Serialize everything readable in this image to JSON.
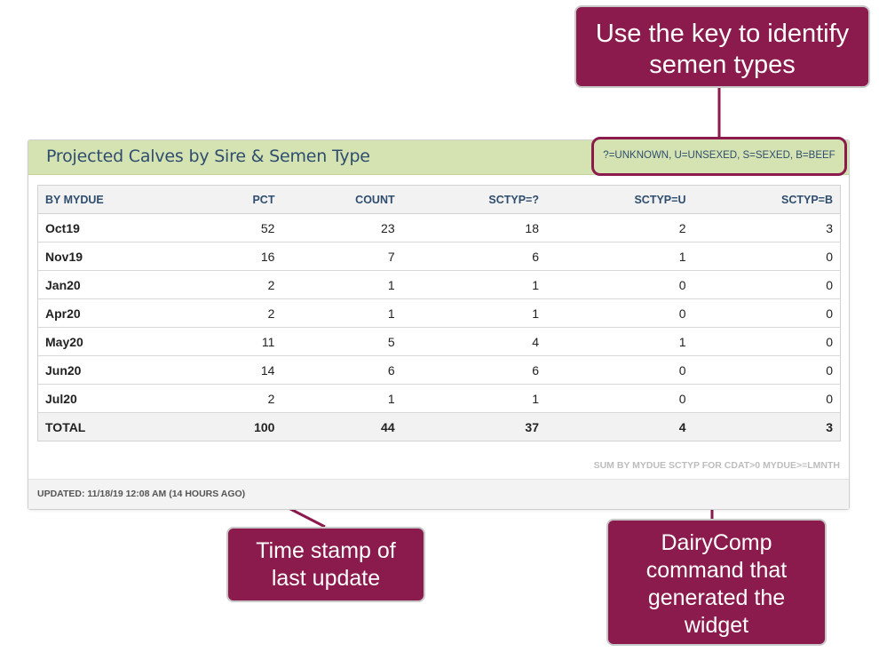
{
  "widget": {
    "title": "Projected Calves by Sire & Semen Type",
    "key": "?=UNKNOWN, U=UNSEXED, S=SEXED, B=BEEF",
    "command": "SUM BY MYDUE SCTYP FOR CDAT>0 MYDUE>=LMNTH",
    "updated": "UPDATED: 11/18/19 12:08 AM (14 HOURS AGO)"
  },
  "table": {
    "headers": [
      "BY MYDUE",
      "PCT",
      "COUNT",
      "SCTYP=?",
      "SCTYP=U",
      "SCTYP=B"
    ],
    "rows": [
      [
        "Oct19",
        "52",
        "23",
        "18",
        "2",
        "3"
      ],
      [
        "Nov19",
        "16",
        "7",
        "6",
        "1",
        "0"
      ],
      [
        "Jan20",
        "2",
        "1",
        "1",
        "0",
        "0"
      ],
      [
        "Apr20",
        "2",
        "1",
        "1",
        "0",
        "0"
      ],
      [
        "May20",
        "11",
        "5",
        "4",
        "1",
        "0"
      ],
      [
        "Jun20",
        "14",
        "6",
        "6",
        "0",
        "0"
      ],
      [
        "Jul20",
        "2",
        "1",
        "1",
        "0",
        "0"
      ]
    ],
    "total": [
      "TOTAL",
      "100",
      "44",
      "37",
      "4",
      "3"
    ]
  },
  "callouts": {
    "key_note": [
      "Use the key to identify",
      "semen types"
    ],
    "time_note": [
      "Time stamp of",
      "last update"
    ],
    "command_note": [
      "DairyComp",
      "command that",
      "generated the",
      "widget"
    ]
  },
  "colors": {
    "header_bg": "#d5e3b2",
    "title_text": "#2f4d6e",
    "callout_bg": "#8b1a4d"
  }
}
